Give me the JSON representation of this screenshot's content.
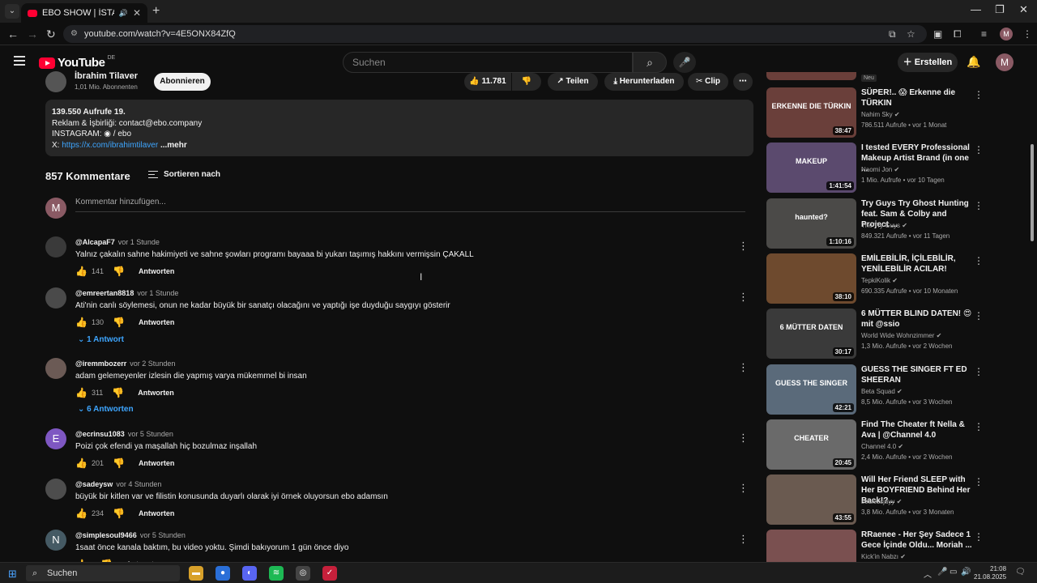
{
  "browser": {
    "tab_title": "EBO SHOW | İSTANBUL FES",
    "url": "youtube.com/watch?v=4E5ONX84ZfQ",
    "profile_initial": "M"
  },
  "header": {
    "logo_text": "YouTube",
    "country": "DE",
    "search_placeholder": "Suchen",
    "create_label": "Erstellen",
    "avatar_initial": "M"
  },
  "channel": {
    "name": "İbrahim Tilaver",
    "subscribers": "1,01 Mio. Abonnenten",
    "subscribe_label": "Abonnieren",
    "likes": "11.781",
    "share_label": "Teilen",
    "download_label": "Herunterladen",
    "clip_label": "Clip"
  },
  "description": {
    "stats": "139.550 Aufrufe  19.",
    "line1": "Reklam & İşbirliği: contact@ebo.company",
    "line2_prefix": "INSTAGRAM:",
    "line2_suffix": "/ ebo",
    "line3_prefix": "X:",
    "line3_link": "https://x.com/ibrahimtilaver",
    "more": "...mehr"
  },
  "comments": {
    "count_label": "857 Kommentare",
    "sort_label": "Sortieren nach",
    "add_placeholder": "Kommentar hinzufügen...",
    "add_avatar": "M",
    "reply_label": "Antworten",
    "items": [
      {
        "handle": "@AlcapaF7",
        "time": "vor 1 Stunde",
        "text": "Yalnız çakalın sahne hakimiyeti ve sahne şowları programı bayaaa bi yukarı taşımış hakkını vermişsin ÇAKALL",
        "likes": "141",
        "initial": "",
        "color": "#3a3a3a"
      },
      {
        "handle": "@emreertan8818",
        "time": "vor 1 Stunde",
        "text": "Ati'nin canlı söylemesi, onun ne kadar büyük bir sanatçı olacağını ve yaptığı işe duyduğu saygıyı gösterir",
        "likes": "130",
        "initial": "",
        "color": "#4a4a4a",
        "replies": "1 Antwort"
      },
      {
        "handle": "@iremmbozerr",
        "time": "vor 2 Stunden",
        "text": "adam gelemeyenler izlesin die yapmış varya mükemmel bi insan",
        "likes": "311",
        "initial": "",
        "color": "#6b5a55",
        "replies": "6 Antworten"
      },
      {
        "handle": "@ecrinsu1083",
        "time": "vor 5 Stunden",
        "text": "Poizi çok efendi ya maşallah hiç bozulmaz inşallah",
        "likes": "201",
        "initial": "E",
        "color": "#7e57c2"
      },
      {
        "handle": "@sadeysw",
        "time": "vor 4 Stunden",
        "text": "büyük bir kitlen var ve filistin konusunda duyarlı olarak iyi örnek oluyorsun ebo adamsın",
        "likes": "234",
        "initial": "",
        "color": "#4d4d4d"
      },
      {
        "handle": "@simplesoul9466",
        "time": "vor 5 Stunden",
        "text": "1saat önce kanala baktım, bu video yoktu. Şimdi bakıyorum 1 gün önce diyo",
        "likes": "",
        "initial": "N",
        "color": "#455a64"
      }
    ]
  },
  "sidebar": {
    "top_badge": "Neu",
    "items": [
      {
        "title": "SÜPER!.. 😱 Erkenne die TÜRKIN",
        "channel": "Nahim Sky",
        "meta": "786.511 Aufrufe • vor 1 Monat",
        "duration": "38:47",
        "thumb": "#6a3f3a",
        "thumb_text": "ERKENNE DIE TÜRKIN"
      },
      {
        "title": "I tested EVERY Professional Makeup Artist Brand (in one ...",
        "channel": "Naomi Jon",
        "meta": "1 Mio. Aufrufe • vor 10 Tagen",
        "duration": "1:41:54",
        "thumb": "#5b4a6e",
        "thumb_text": "MAKEUP"
      },
      {
        "title": "Try Guys Try Ghost Hunting feat. Sam & Colby and Project ...",
        "channel": "The Try Guys",
        "meta": "849.321 Aufrufe • vor 11 Tagen",
        "duration": "1:10:16",
        "thumb": "#4b4a48",
        "thumb_text": "haunted?"
      },
      {
        "title": "EMİLEBİLİR, İÇİLEBİLİR, YENİLEBİLİR ACILAR!",
        "channel": "TepkiKolik",
        "meta": "690.335 Aufrufe • vor 10 Monaten",
        "duration": "38:10",
        "thumb": "#6e4a2e",
        "thumb_text": ""
      },
      {
        "title": "6 MÜTTER BLIND DATEN! 😍 mit @ssio",
        "channel": "World Wide Wohnzimmer",
        "meta": "1,3 Mio. Aufrufe • vor 2 Wochen",
        "duration": "30:17",
        "thumb": "#3a3a3a",
        "thumb_text": "6 MÜTTER DATEN"
      },
      {
        "title": "GUESS THE SINGER FT ED SHEERAN",
        "channel": "Beta Squad",
        "meta": "8,5 Mio. Aufrufe • vor 3 Wochen",
        "duration": "42:21",
        "thumb": "#5a6a7a",
        "thumb_text": "GUESS THE SINGER"
      },
      {
        "title": "Find The Cheater ft Nella & Ava | @Channel 4.0",
        "channel": "Channel 4.0",
        "meta": "2,4 Mio. Aufrufe • vor 2 Wochen",
        "duration": "20:45",
        "thumb": "#6a6a6a",
        "thumb_text": "CHEATER"
      },
      {
        "title": "Will Her Friend SLEEP with Her BOYFRIEND Behind Her Back!?...",
        "channel": "soulessjayy",
        "meta": "3,8 Mio. Aufrufe • vor 3 Monaten",
        "duration": "43:55",
        "thumb": "#6a5a50",
        "thumb_text": ""
      },
      {
        "title": "RRaenee  - Her Şey Sadece 1 Gece İçinde Oldu... Moriah ...",
        "channel": "Kick'in Nabzı",
        "meta": "",
        "duration": "",
        "thumb": "#7a5050",
        "thumb_text": ""
      }
    ]
  },
  "taskbar": {
    "search_label": "Suchen",
    "time": "21:08",
    "date": "21.08.2025"
  },
  "colors": {
    "background": "#0f0f0f",
    "accent_red": "#ff0033",
    "link_blue": "#3ea6ff"
  }
}
